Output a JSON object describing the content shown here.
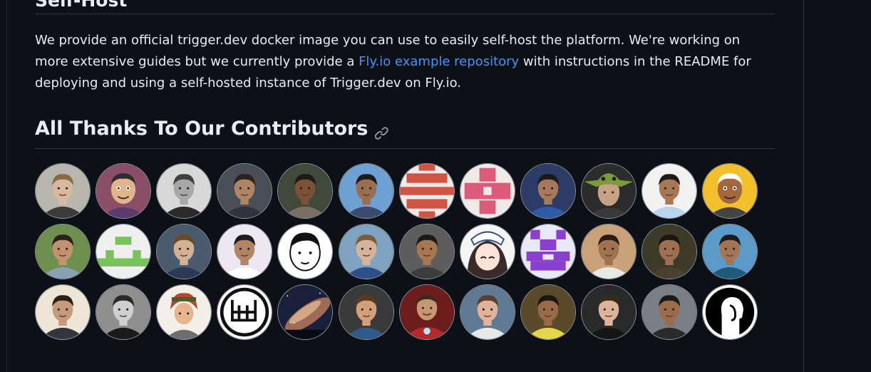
{
  "section_top": {
    "title": "Self-Host"
  },
  "selfhost": {
    "text_before": "We provide an official trigger.dev docker image you can use to easily self-host the platform. We're working on more extensive guides but we currently provide a ",
    "link_text": "Fly.io example repository",
    "text_after": " with instructions in the README for deploying and using a self-hosted instance of Trigger.dev on Fly.io."
  },
  "contributors": {
    "title": "All Thanks To Our Contributors",
    "avatars": [
      {
        "kind": "photo",
        "bg": "#b9b6b0",
        "skin": "#d9b8a0",
        "hair": "#8a6a45",
        "shirt": "#3b3b3b"
      },
      {
        "kind": "cartoon",
        "bg": "#8a4f66",
        "skin": "#e2b48d",
        "hair": "#2e2e2e",
        "shirt": "#5b3b6e"
      },
      {
        "kind": "photo",
        "bg": "#d8d8d8",
        "skin": "#a8a8a8",
        "hair": "#404040",
        "shirt": "#2a2a2a"
      },
      {
        "kind": "photo",
        "bg": "#4a4f57",
        "skin": "#b08466",
        "hair": "#2a2320",
        "shirt": "#2e3440"
      },
      {
        "kind": "photo",
        "bg": "#3f4a3b",
        "skin": "#7a5136",
        "hair": "#1e1a16",
        "shirt": "#7d6e62"
      },
      {
        "kind": "photo",
        "bg": "#6fa0d3",
        "skin": "#9a6e50",
        "hair": "#1c1c1c",
        "shirt": "#3a4a70"
      },
      {
        "kind": "identicon",
        "bg": "#f0e9e7",
        "fg": "#d05545",
        "pattern": "stripes"
      },
      {
        "kind": "identicon",
        "bg": "#f0e9e7",
        "fg": "#dc5a7a",
        "pattern": "plus"
      },
      {
        "kind": "photo",
        "bg": "#2c3c66",
        "skin": "#a6795a",
        "hair": "#1a1a1a",
        "shirt": "#2f5aa8"
      },
      {
        "kind": "yoda",
        "bg": "#2c2c2c",
        "skin": "#c8a284",
        "hair": "#7c9c3c",
        "shirt": "#3a3a3a"
      },
      {
        "kind": "photo",
        "bg": "#f2f2f2",
        "skin": "#a87854",
        "hair": "#1e1a16",
        "shirt": "#b9d4ec"
      },
      {
        "kind": "cartoon",
        "bg": "#f2c02a",
        "skin": "#a4683e",
        "hair": "#ffffff",
        "shirt": "#444444"
      },
      {
        "kind": "photo",
        "bg": "#6e8f4e",
        "skin": "#c2926c",
        "hair": "#2a2118",
        "shirt": "#8aa0b4"
      },
      {
        "kind": "identicon",
        "bg": "#efefef",
        "fg": "#78c35c",
        "pattern": "smile"
      },
      {
        "kind": "photo",
        "bg": "#4c5a6e",
        "skin": "#d3b294",
        "hair": "#6a4a2a",
        "shirt": "#2a3a55"
      },
      {
        "kind": "photo",
        "bg": "#ede7f1",
        "skin": "#b18466",
        "hair": "#1c1c1c",
        "shirt": "#ffffff"
      },
      {
        "kind": "drawing",
        "bg": "#ffffff",
        "skin": "#ffffff",
        "hair": "#111111",
        "shirt": "#ffffff"
      },
      {
        "kind": "photo",
        "bg": "#7ea2c0",
        "skin": "#d6b49a",
        "hair": "#7a5c3c",
        "shirt": "#2f4f8a"
      },
      {
        "kind": "photo",
        "bg": "#5d5d5d",
        "skin": "#a87650",
        "hair": "#1a1a1a",
        "shirt": "#3d3d3d"
      },
      {
        "kind": "anime",
        "bg": "#f5f5f5",
        "skin": "#ffe2d6",
        "hair": "#3a2a2a",
        "shirt": "#2f4c8a"
      },
      {
        "kind": "identicon",
        "bg": "#e9e6f5",
        "fg": "#8b3fcf",
        "pattern": "blocks"
      },
      {
        "kind": "photo",
        "bg": "#c9a27a",
        "skin": "#a1724f",
        "hair": "#2a1e14",
        "shirt": "#e8e8e8"
      },
      {
        "kind": "photo",
        "bg": "#3e3a2a",
        "skin": "#9c7050",
        "hair": "#1a1612",
        "shirt": "#4a4030"
      },
      {
        "kind": "photo",
        "bg": "#5b9ac9",
        "skin": "#a47456",
        "hair": "#1c1c1c",
        "shirt": "#1e5a7a"
      },
      {
        "kind": "photo",
        "bg": "#efe5d6",
        "skin": "#c69a7a",
        "hair": "#2a2018",
        "shirt": "#34343c"
      },
      {
        "kind": "photo",
        "bg": "#8f8f8f",
        "skin": "#cfcfcf",
        "hair": "#2a2a2a",
        "shirt": "#1a1a1a"
      },
      {
        "kind": "hero",
        "bg": "#f3efe8",
        "skin": "#e6b48f",
        "hair": "#b7472a",
        "shirt": "#6e6e6e"
      },
      {
        "kind": "logo",
        "bg": "#111111",
        "fg": "#ffffff"
      },
      {
        "kind": "galaxy",
        "bg": "#1a1f3a",
        "fg": "#d98a62"
      },
      {
        "kind": "photo",
        "bg": "#3a3a3a",
        "skin": "#d4a07a",
        "hair": "#5a3a22",
        "shirt": "#2f5a8a"
      },
      {
        "kind": "ironman",
        "bg": "#6e1d1d",
        "skin": "#c69872",
        "hair": "#3a2a20",
        "shirt": "#b42a2a"
      },
      {
        "kind": "photo",
        "bg": "#607a94",
        "skin": "#e1b29a",
        "hair": "#5a4030",
        "shirt": "#e8e8e8"
      },
      {
        "kind": "photo",
        "bg": "#5a4a2a",
        "skin": "#9a6a48",
        "hair": "#1a1612",
        "shirt": "#e4d64a"
      },
      {
        "kind": "photo",
        "bg": "#2a2a2a",
        "skin": "#dcb49c",
        "hair": "#3a2a1e",
        "shirt": "#151515"
      },
      {
        "kind": "photo",
        "bg": "#7a7f86",
        "skin": "#9a6c4c",
        "hair": "#1a1a1a",
        "shirt": "#2a2a2a"
      },
      {
        "kind": "silhouette",
        "bg": "#000000",
        "fg": "#ffffff"
      }
    ]
  }
}
